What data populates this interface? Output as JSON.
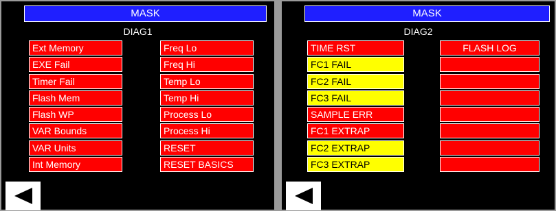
{
  "panel1": {
    "header": "MASK",
    "title": "DIAG1",
    "left_buttons": [
      "Ext Memory",
      "EXE Fail",
      "Timer Fail",
      "Flash Mem",
      "Flash WP",
      "VAR Bounds",
      "VAR Units",
      "Int Memory"
    ],
    "right_buttons": [
      "Freq Lo",
      "Freq Hi",
      "Temp Lo",
      "Temp Hi",
      "Process Lo",
      "Process Hi",
      "RESET",
      "RESET BASICS"
    ]
  },
  "panel2": {
    "header": "MASK",
    "title": "DIAG2",
    "left_buttons": [
      {
        "label": "TIME RST",
        "color": "red"
      },
      {
        "label": "FC1 FAIL",
        "color": "yellow"
      },
      {
        "label": "FC2 FAIL",
        "color": "yellow"
      },
      {
        "label": "FC3 FAIL",
        "color": "yellow"
      },
      {
        "label": "SAMPLE ERR",
        "color": "red"
      },
      {
        "label": "FC1 EXTRAP",
        "color": "red"
      },
      {
        "label": "FC2 EXTRAP",
        "color": "yellow"
      },
      {
        "label": "FC3 EXTRAP",
        "color": "yellow"
      }
    ],
    "right_buttons": [
      "FLASH LOG",
      "",
      "",
      "",
      "",
      "",
      "",
      ""
    ]
  },
  "colors": {
    "red": "#ff0000",
    "yellow": "#ffff00",
    "header_blue": "#1f1fff"
  },
  "icons": {
    "back": "back-arrow-icon"
  }
}
